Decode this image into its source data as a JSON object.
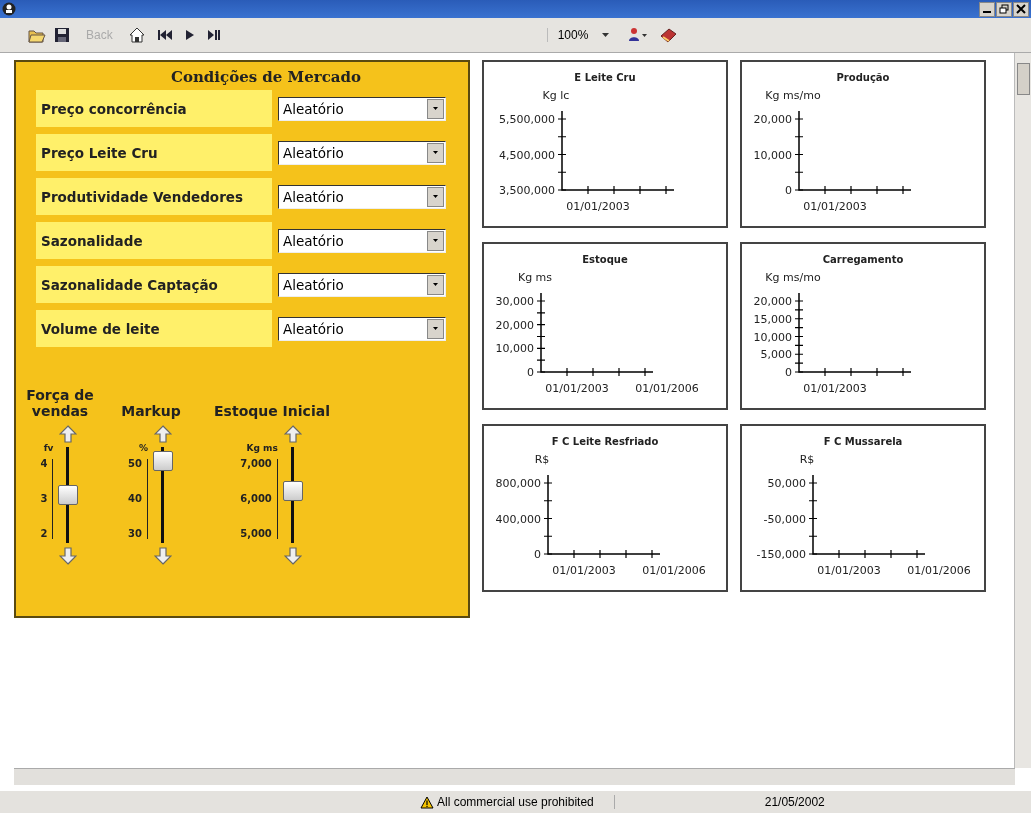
{
  "toolbar": {
    "back": {
      "label": "Back",
      "disabled": true
    },
    "zoom": "100%"
  },
  "market": {
    "title": "Condições de Mercado",
    "rows": [
      {
        "label": "Preço concorrência",
        "value": "Aleatório"
      },
      {
        "label": "Preço Leite Cru",
        "value": "Aleatório"
      },
      {
        "label": "Produtividade Vendedores",
        "value": "Aleatório"
      },
      {
        "label": "Sazonalidade",
        "value": "Aleatório"
      },
      {
        "label": "Sazonalidade Captação",
        "value": "Aleatório"
      },
      {
        "label": "Volume de leite",
        "value": "Aleatório"
      }
    ]
  },
  "sliders": [
    {
      "title": "Força de vendas",
      "unit": "fv",
      "ticks": [
        "4",
        "3",
        "2"
      ],
      "level": 0.5
    },
    {
      "title": "Markup",
      "unit": "%",
      "ticks": [
        "50",
        "40",
        "30"
      ],
      "level": 0.95
    },
    {
      "title": "Estoque Inicial",
      "unit": "Kg ms",
      "ticks": [
        "7,000",
        "6,000",
        "5,000"
      ],
      "level": 0.55
    }
  ],
  "charts": [
    {
      "title": "E Leite Cru",
      "unit": "Kg lc",
      "yticks": [
        "5,500,000",
        "4,500,000",
        "3,500,000"
      ],
      "xlabels": [
        "01/01/2003"
      ]
    },
    {
      "title": "Produção",
      "unit": "Kg ms/mo",
      "yticks": [
        "20,000",
        "10,000",
        "0"
      ],
      "xlabels": [
        "01/01/2003"
      ]
    },
    {
      "title": "Estoque",
      "unit": "Kg ms",
      "yticks": [
        "30,000",
        "20,000",
        "10,000",
        "0"
      ],
      "xlabels": [
        "01/01/2003",
        "01/01/2006"
      ]
    },
    {
      "title": "Carregamento",
      "unit": "Kg ms/mo",
      "yticks": [
        "20,000",
        "15,000",
        "10,000",
        "5,000",
        "0"
      ],
      "xlabels": [
        "01/01/2003"
      ]
    },
    {
      "title": "F C Leite Resfriado",
      "unit": "R$",
      "yticks": [
        "800,000",
        "400,000",
        "0"
      ],
      "xlabels": [
        "01/01/2003",
        "01/01/2006"
      ]
    },
    {
      "title": "F C Mussarela",
      "unit": "R$",
      "yticks": [
        "50,000",
        "-50,000",
        "-150,000"
      ],
      "xlabels": [
        "01/01/2003",
        "01/01/2006"
      ]
    }
  ],
  "status_bar": {
    "warning": "All commercial use prohibited",
    "date": "21/05/2002"
  }
}
